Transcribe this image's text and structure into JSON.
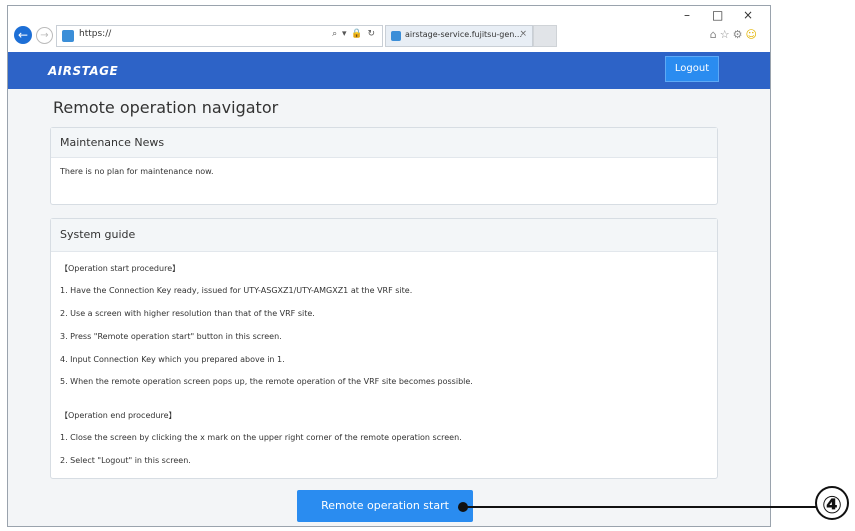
{
  "browser": {
    "back_icon": "back-arrow-icon",
    "forward_icon": "forward-arrow-icon",
    "address": "https://",
    "address_tools": "⌕ ▾ 🔒 ↻",
    "tab_title": "airstage-service.fujitsu-gen...",
    "tab_close": "×",
    "window_controls": {
      "minimize": "–",
      "maximize": "□",
      "close": "×"
    },
    "toolbar_icons": [
      "home-icon",
      "star-icon",
      "settings-icon",
      "smiley-icon"
    ]
  },
  "header": {
    "logo": "AIRSTAGE",
    "logout_label": "Logout"
  },
  "page_title": "Remote operation navigator",
  "maintenance": {
    "title": "Maintenance News",
    "message": "There is no plan for maintenance now."
  },
  "guide": {
    "title": "System guide",
    "lines": [
      "【Operation start procedure】",
      "1. Have the Connection Key ready, issued for UTY-ASGXZ1/UTY-AMGXZ1 at the VRF site.",
      "2. Use a screen with higher resolution than that of the VRF site.",
      "3. Press \"Remote operation start\" button in this screen.",
      "4. Input Connection Key which you prepared above in 1.",
      "5. When the remote operation screen pops up, the remote operation of the VRF site becomes possible.",
      "【Operation end procedure】",
      "1. Close the screen by clicking the x mark on the upper right corner of the remote operation screen.",
      "2. Select \"Logout\" in this screen."
    ]
  },
  "start_button_label": "Remote operation start",
  "callout_label": "④",
  "colors": {
    "header_blue": "#2d63c7",
    "button_blue": "#2a8cf0"
  }
}
